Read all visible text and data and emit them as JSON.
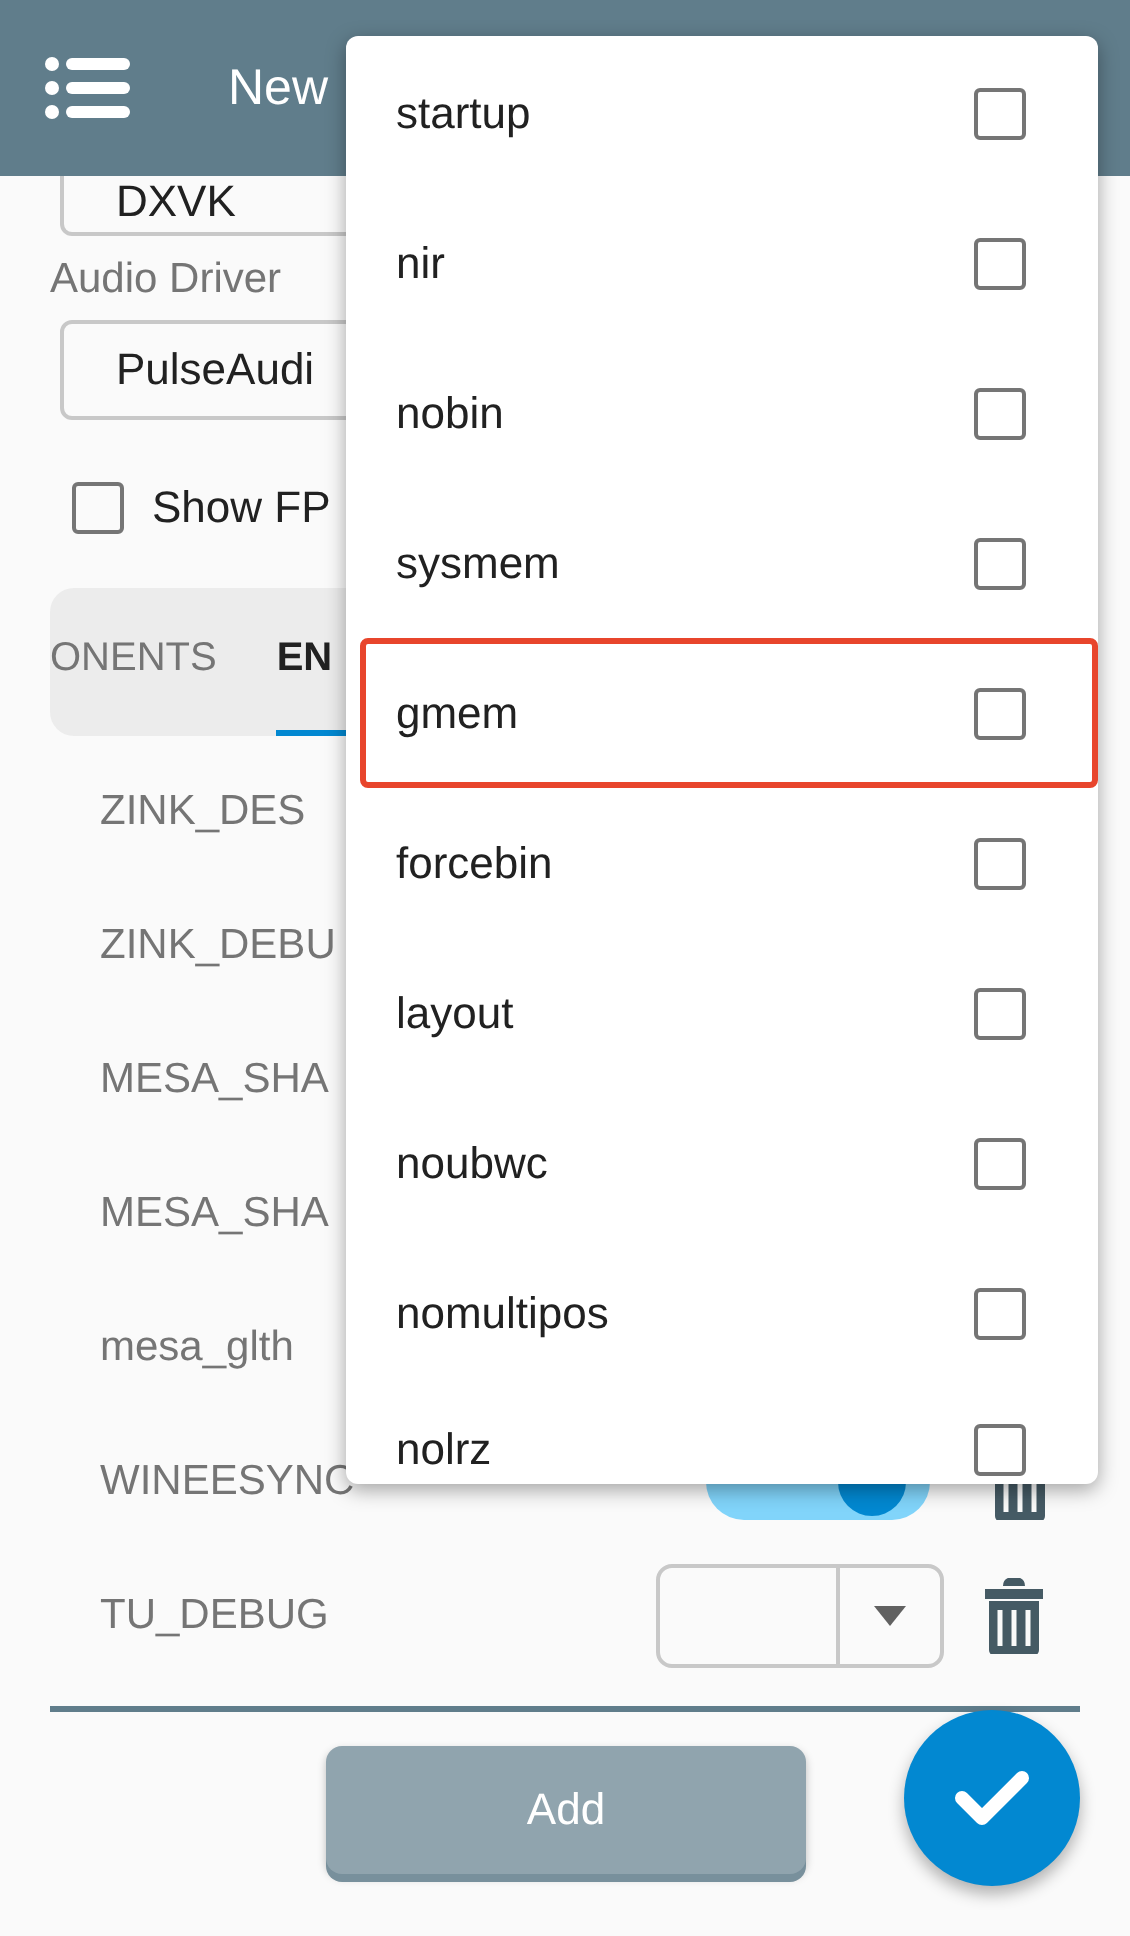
{
  "header": {
    "title": "New"
  },
  "form": {
    "graphics_value": "DXVK",
    "audio_label": "Audio Driver",
    "audio_value": "PulseAudi",
    "show_fps": {
      "label": "Show FP",
      "checked": false
    }
  },
  "tabs": [
    {
      "label": "ONENTS",
      "selected": false
    },
    {
      "label": "EN",
      "selected": true
    }
  ],
  "env_vars": [
    {
      "name": "ZINK_DES",
      "kind": "hidden"
    },
    {
      "name": "ZINK_DEBU",
      "kind": "hidden"
    },
    {
      "name": "MESA_SHA",
      "kind": "hidden"
    },
    {
      "name": "MESA_SHA",
      "kind": "hidden"
    },
    {
      "name": "mesa_glth",
      "kind": "hidden"
    },
    {
      "name": "WINEESYNC",
      "kind": "toggle",
      "on": true
    },
    {
      "name": "TU_DEBUG",
      "kind": "select"
    }
  ],
  "add_button": "Add",
  "menu": {
    "items": [
      {
        "label": "startup",
        "checked": false,
        "highlighted": false
      },
      {
        "label": "nir",
        "checked": false,
        "highlighted": false
      },
      {
        "label": "nobin",
        "checked": false,
        "highlighted": false
      },
      {
        "label": "sysmem",
        "checked": false,
        "highlighted": false
      },
      {
        "label": "gmem",
        "checked": false,
        "highlighted": true
      },
      {
        "label": "forcebin",
        "checked": false,
        "highlighted": false
      },
      {
        "label": "layout",
        "checked": false,
        "highlighted": false
      },
      {
        "label": "noubwc",
        "checked": false,
        "highlighted": false
      },
      {
        "label": "nomultipos",
        "checked": false,
        "highlighted": false
      },
      {
        "label": "nolrz",
        "checked": false,
        "highlighted": false
      }
    ]
  }
}
